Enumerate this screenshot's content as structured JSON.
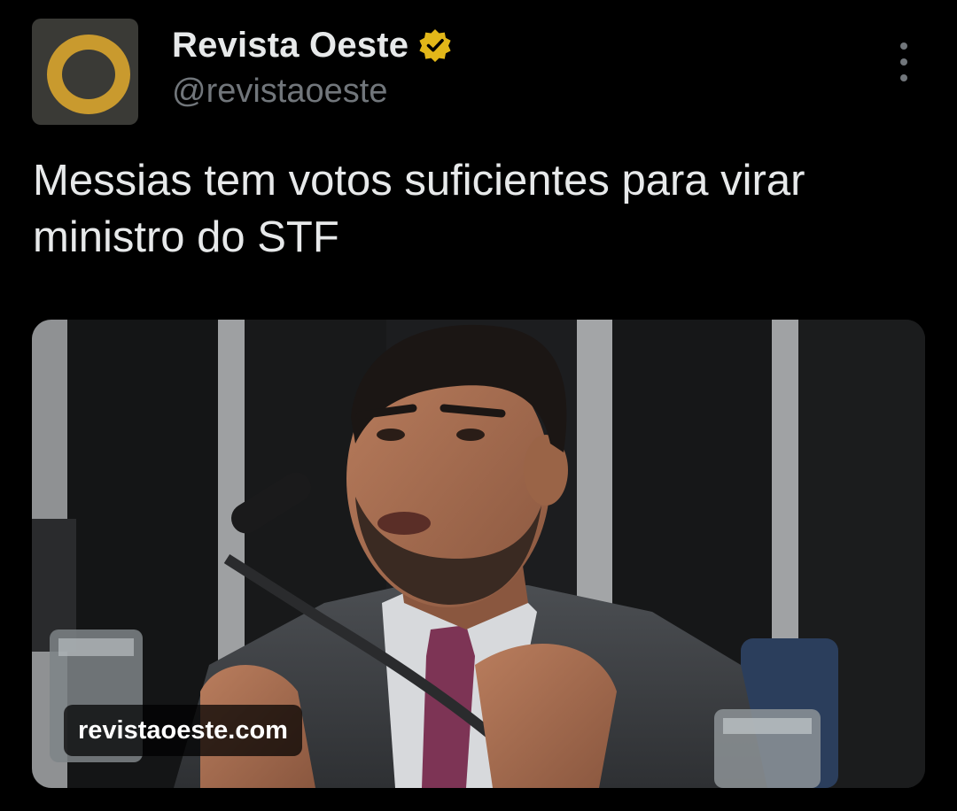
{
  "tweet": {
    "author": {
      "name": "Revista Oeste",
      "handle": "@revistaoeste",
      "verified": true,
      "avatar_letter": "O",
      "avatar_color": "#c99a2e",
      "badge_color": "#e2b719"
    },
    "text": "Messias tem votos suficientes para virar ministro do STF",
    "media": {
      "type": "photo",
      "domain": "revistaoeste.com"
    },
    "menu_icon": "more-vertical-icon"
  }
}
